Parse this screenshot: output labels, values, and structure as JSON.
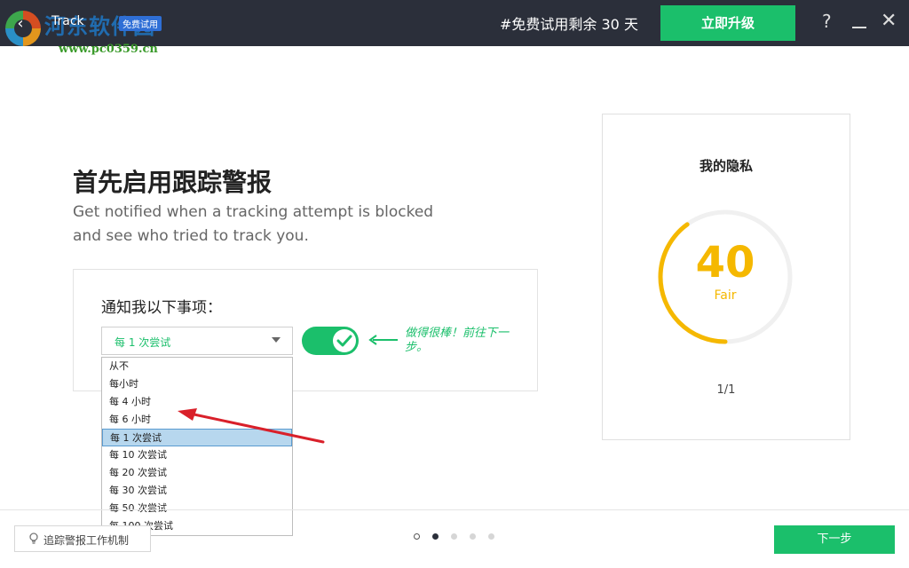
{
  "titlebar": {
    "app_title": "Track",
    "trial_badge": "免费试用",
    "watermark": "河东软件园",
    "watermark_url": "www.pc0359.cn",
    "trial_remaining": "#免费试用剩余 30 天",
    "upgrade_label": "立即升级",
    "help_label": "?",
    "close_label": "✕"
  },
  "main": {
    "heading": "首先启用跟踪警报",
    "subtext": "Get notified when a tracking attempt is blocked and see who tried to track you.",
    "notify_label": "通知我以下事项：",
    "select_value": "每 1 次尝试",
    "toggle_on": true,
    "hint_text": "做得很棒！前往下一步。"
  },
  "dropdown": {
    "options": [
      "从不",
      "每小时",
      "每 4 小时",
      "每 6 小时",
      "每 1 次尝试",
      "每 10 次尝试",
      "每 20 次尝试",
      "每 30 次尝试",
      "每 50 次尝试",
      "每 100 次尝试"
    ],
    "selected_index": 4
  },
  "privacy": {
    "title": "我的隐私",
    "score": "40",
    "rating": "Fair",
    "score_max": 100,
    "pager": "1/1"
  },
  "footer": {
    "mechanism_label": "追踪警报工作机制",
    "next_label": "下一步",
    "steps_total": 5,
    "steps_current": 2
  },
  "colors": {
    "accent": "#1bbf6b",
    "titlebar": "#2b2f3a",
    "score": "#f5b800",
    "arrow": "#d9202a",
    "selected": "#b7d7ee"
  },
  "icons": {
    "back": "back-arrow-icon",
    "help": "help-icon",
    "minimize": "minimize-icon",
    "close": "close-icon",
    "check": "check-icon",
    "bulb": "lightbulb-icon"
  }
}
